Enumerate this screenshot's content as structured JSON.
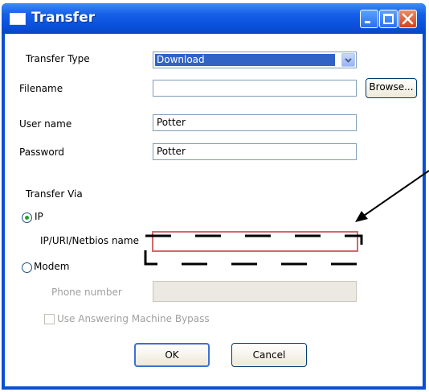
{
  "window": {
    "title": "Transfer"
  },
  "form": {
    "transfer_type_label": "Transfer Type",
    "transfer_type_value": "Download",
    "filename_label": "Filename",
    "filename_value": "",
    "browse_label": "Browse...",
    "username_label": "User name",
    "username_value": "Potter",
    "password_label": "Password",
    "password_value": "Potter",
    "transfer_via_label": "Transfer Via",
    "ip_radio_label": "IP",
    "ip_field_label": "IP/URI/Netbios name",
    "ip_field_value": "",
    "modem_radio_label": "Modem",
    "phone_label": "Phone number",
    "phone_value": "",
    "bypass_label": "Use Answering Machine Bypass"
  },
  "buttons": {
    "ok_label": "OK",
    "cancel_label": "Cancel"
  },
  "icons": [
    "window-icon",
    "minimize-icon",
    "maximize-icon",
    "close-icon",
    "dropdown-arrow-icon",
    "annotation-arrow-icon"
  ],
  "colors": {
    "titlebar": "#0a52dd",
    "selection": "#3163c5",
    "radio_dot": "#21a121",
    "highlight_border": "#d06a6a",
    "disabled_text": "#a0a0a0"
  }
}
